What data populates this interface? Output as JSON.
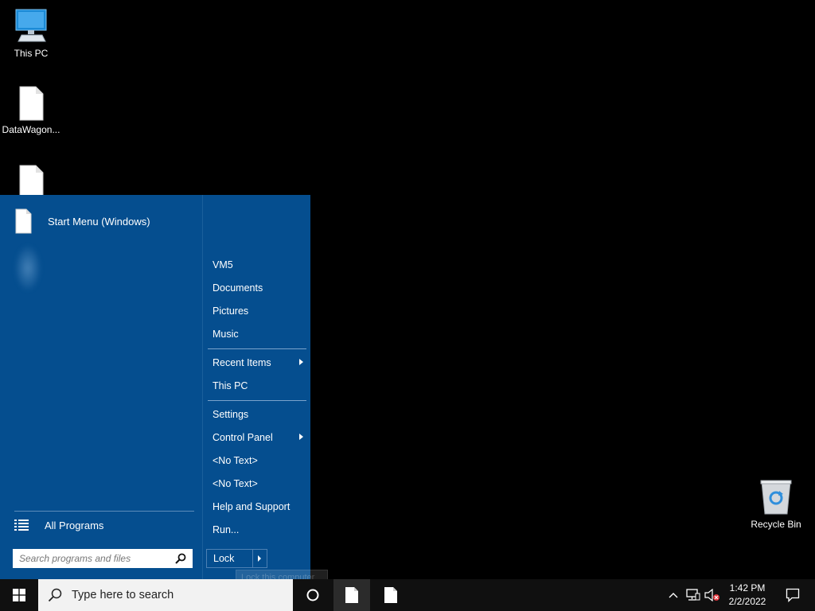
{
  "desktop": {
    "icons": [
      {
        "label": "This PC",
        "icon": "monitor-icon"
      },
      {
        "label": "DataWagon...",
        "icon": "file-icon"
      },
      {
        "label": "",
        "icon": "file-icon"
      },
      {
        "label": "Recycle Bin",
        "icon": "recycle-bin-icon"
      }
    ]
  },
  "start_menu": {
    "pinned": {
      "label": "Start Menu (Windows)",
      "icon": "file-icon"
    },
    "all_programs": {
      "label": "All Programs",
      "icon": "list-icon"
    },
    "search": {
      "placeholder": "Search programs and files",
      "icon": "search-icon"
    },
    "right_items": [
      {
        "label": "VM5"
      },
      {
        "label": "Documents"
      },
      {
        "label": "Pictures"
      },
      {
        "label": "Music"
      },
      {
        "label": "Recent Items",
        "submenu": true
      },
      {
        "label": "This PC"
      },
      {
        "label": "Settings"
      },
      {
        "label": "Control Panel",
        "submenu": true
      },
      {
        "label": "<No Text>"
      },
      {
        "label": "<No Text>"
      },
      {
        "label": "Help and Support"
      },
      {
        "label": "Run..."
      }
    ],
    "lock": {
      "label": "Lock"
    },
    "tooltip": "Lock this computer"
  },
  "taskbar": {
    "search_text": "Type here to search",
    "clock": {
      "time": "1:42 PM",
      "date": "2/2/2022"
    },
    "colors": {
      "taskbar": "#101010",
      "start_menu": "#054e8f",
      "search_bg": "#f2f2f2"
    }
  }
}
